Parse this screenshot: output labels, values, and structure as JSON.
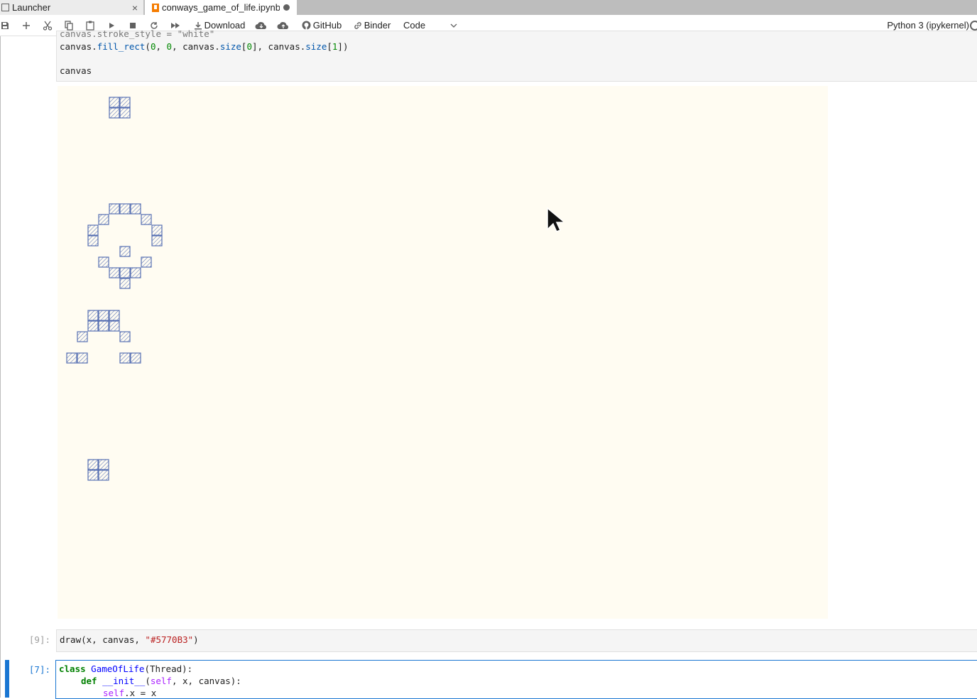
{
  "tabs": [
    {
      "label": "Launcher",
      "icon": "launcher-icon",
      "close": "×"
    },
    {
      "label": "conways_game_of_life.ipynb",
      "icon": "notebook-icon",
      "unsaved": true
    }
  ],
  "toolbar": {
    "save": "save-icon",
    "insert": "add-icon",
    "cut": "cut-icon",
    "copy": "copy-icon",
    "paste": "paste-icon",
    "run": "run-icon",
    "stop": "stop-icon",
    "restart": "restart-icon",
    "run_all": "fast-forward-icon",
    "download_label": "Download",
    "github_label": "GitHub",
    "binder_label": "Binder",
    "cell_type": "Code",
    "kernel": "Python 3 (ipykernel)"
  },
  "cells": {
    "top": {
      "line_partial": "canvas.stroke_style = \"white\"",
      "line2": {
        "a": "canvas.",
        "b": "fill_rect",
        "c": "(",
        "d": "0",
        "e": ", ",
        "f": "0",
        "g": ", canvas.",
        "h": "size",
        "i": "[",
        "j": "0",
        "k": "], canvas.",
        "l": "size",
        "m": "[",
        "n": "1",
        "o": "])"
      },
      "line3": "canvas"
    },
    "draw": {
      "prompt": "[9]:",
      "a": "draw(x, canvas, ",
      "b": "\"#5770B3\"",
      "c": ")"
    },
    "active": {
      "prompt": "[7]:",
      "l1a": "class",
      "l1b": "GameOfLife",
      "l1c": "(Thread):",
      "l2a": "def",
      "l2b": "__init__",
      "l2c": "(",
      "l2d": "self",
      "l2e": ", x, canvas):",
      "l3a": "self",
      "l3b": ".x = x"
    }
  },
  "colors": {
    "cell_fill": "#5770B3",
    "canvas_bg": "#fffcf2",
    "accent": "#1976d2"
  }
}
